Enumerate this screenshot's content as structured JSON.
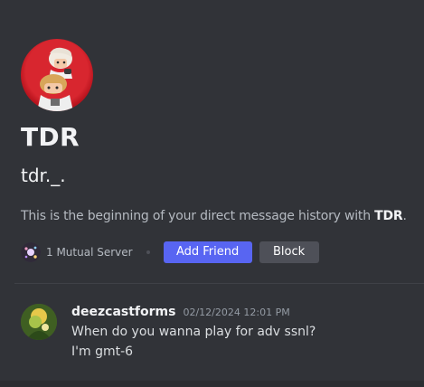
{
  "profile": {
    "display_name": "TDR",
    "username": "tdr._.",
    "avatar_icon": "user-avatar-icon"
  },
  "intro": {
    "prefix": "This is the beginning of your direct message history with ",
    "name": "TDR",
    "suffix": "."
  },
  "actions": {
    "mutual_servers": "1 Mutual Server",
    "add_friend": "Add Friend",
    "block": "Block"
  },
  "message": {
    "author": "deezcastforms",
    "timestamp": "02/12/2024 12:01 PM",
    "lines": [
      "When do you wanna play for adv ssnl?",
      "I'm gmt-6"
    ]
  },
  "colors": {
    "background": "#313338",
    "accent": "#5865f2",
    "secondary_button": "#4e5058"
  }
}
